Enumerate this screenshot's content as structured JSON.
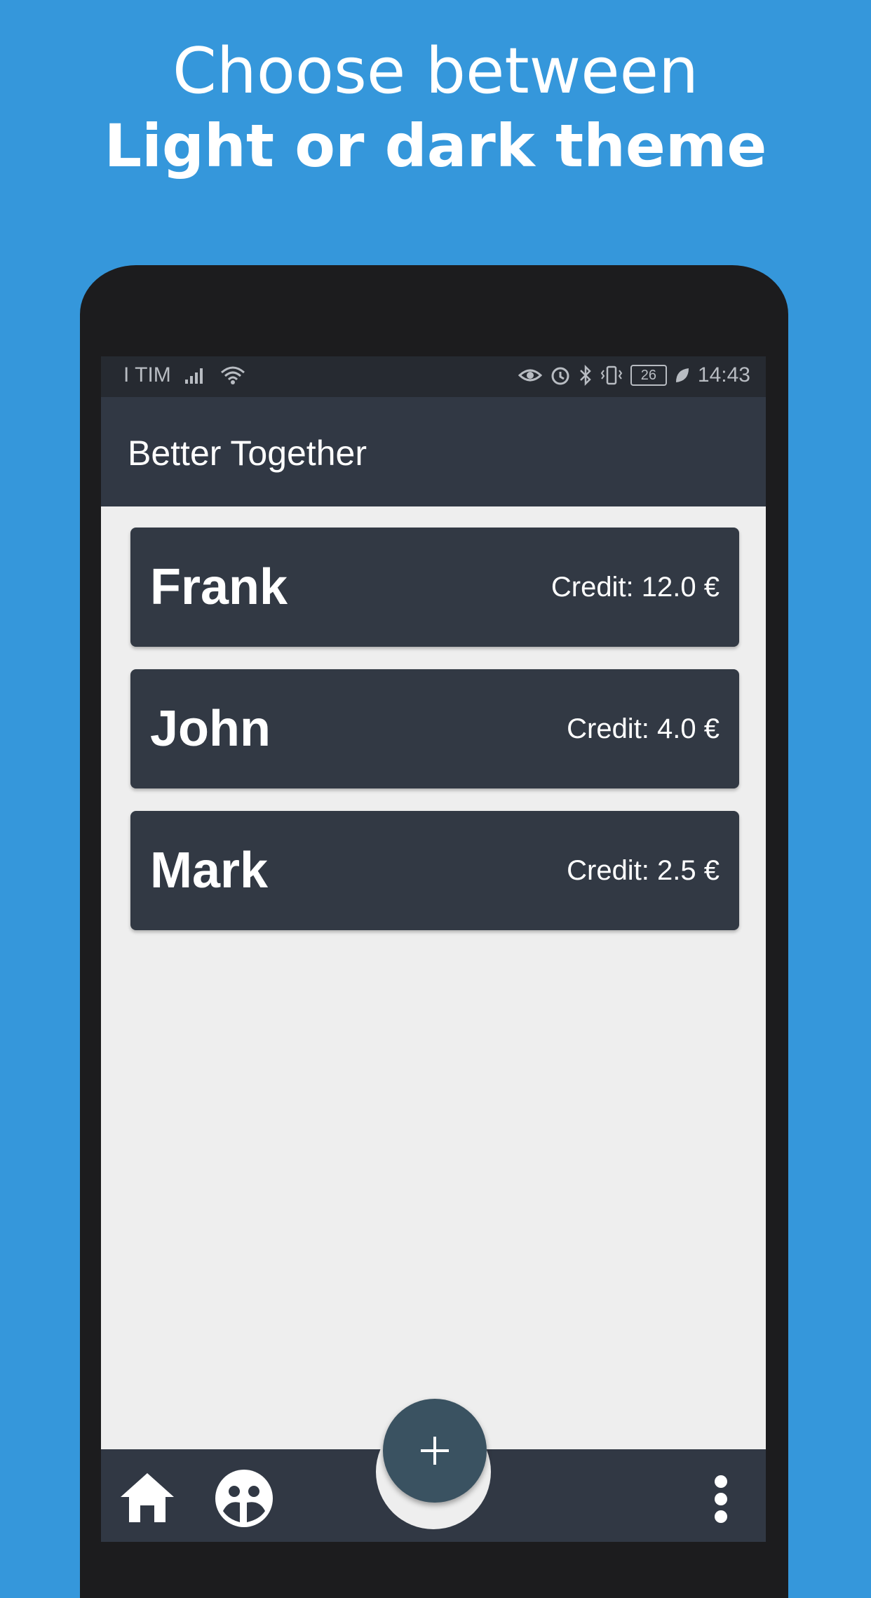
{
  "promo": {
    "line1": "Choose between",
    "line2": "Light or dark theme"
  },
  "status_bar": {
    "carrier": "I TIM",
    "battery_level": "26",
    "time": "14:43",
    "icons": [
      "signal-icon",
      "wifi-icon",
      "eye-icon",
      "alarm-icon",
      "bluetooth-icon",
      "vibrate-icon",
      "battery-icon",
      "leaf-icon"
    ]
  },
  "app_bar": {
    "title": "Better Together"
  },
  "members": [
    {
      "name": "Frank",
      "credit": "Credit: 12.0 €"
    },
    {
      "name": "John",
      "credit": "Credit: 4.0 €"
    },
    {
      "name": "Mark",
      "credit": "Credit: 2.5 €"
    }
  ],
  "fab": {
    "icon": "plus-icon"
  },
  "bottom_nav": {
    "icons": [
      "home-icon",
      "group-icon",
      "more-vert-icon"
    ]
  },
  "colors": {
    "background": "#3597db",
    "app_bar": "#313844",
    "card": "#323944",
    "fab": "#3a5261",
    "screen_bg": "#eeeeee"
  }
}
